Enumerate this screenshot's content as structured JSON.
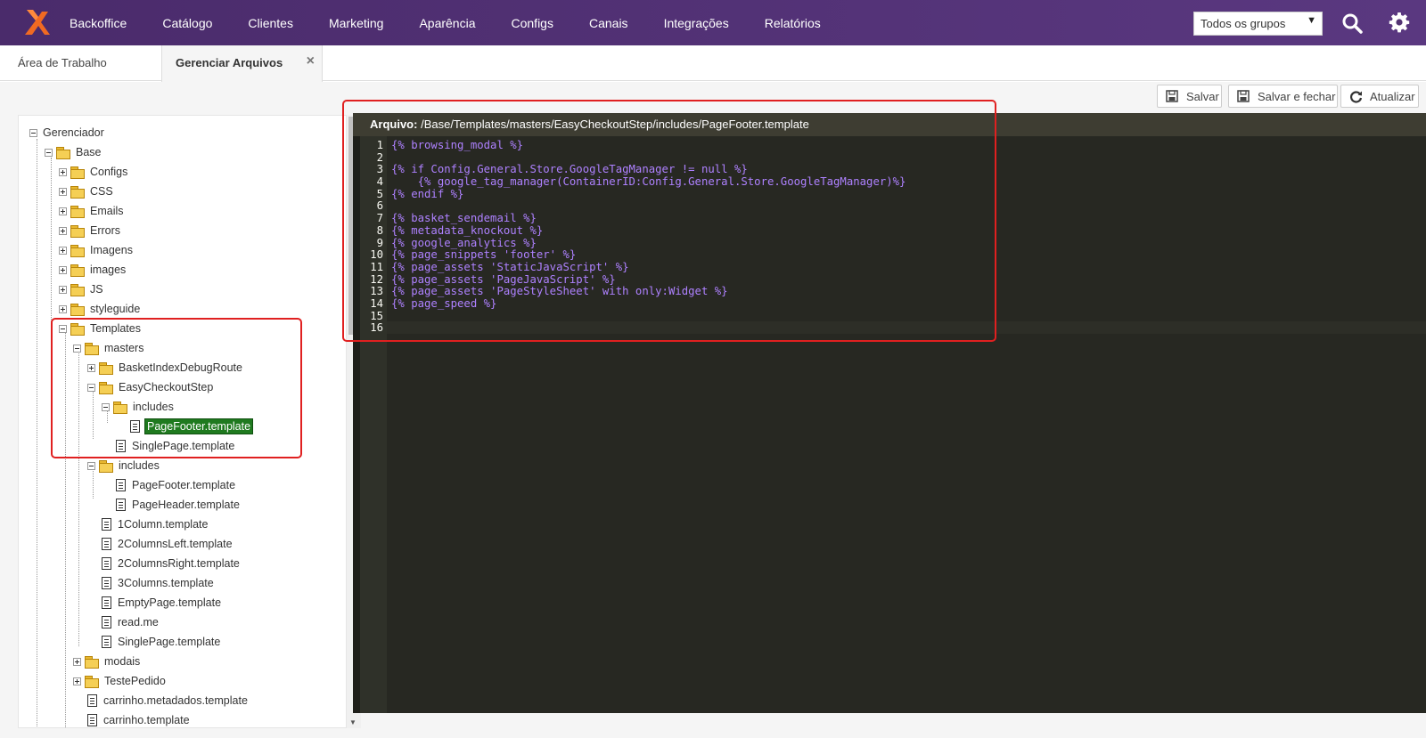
{
  "topbar": {
    "nav": [
      "Backoffice",
      "Catálogo",
      "Clientes",
      "Marketing",
      "Aparência",
      "Configs",
      "Canais",
      "Integrações",
      "Relatórios"
    ],
    "group_select": "Todos os grupos"
  },
  "tabs": {
    "desktop": "Área de Trabalho",
    "files": "Gerenciar Arquivos",
    "close": "×"
  },
  "toolbar": {
    "save": "Salvar",
    "save_close": "Salvar e fechar",
    "refresh": "Atualizar"
  },
  "tree": {
    "root": "Gerenciador",
    "base": "Base",
    "base_folders": [
      "Configs",
      "CSS",
      "Emails",
      "Errors",
      "Imagens",
      "images",
      "JS",
      "styleguide"
    ],
    "templates": "Templates",
    "masters": "masters",
    "basket_debug": "BasketIndexDebugRoute",
    "easy_checkout": "EasyCheckoutStep",
    "ec_includes": "includes",
    "ec_pagefooter": "PageFooter.template",
    "ec_singlepage": "SinglePage.template",
    "t_includes": "includes",
    "t_includes_files": [
      "PageFooter.template",
      "PageHeader.template"
    ],
    "t_files": [
      "1Column.template",
      "2ColumnsLeft.template",
      "2ColumnsRight.template",
      "3Columns.template",
      "EmptyPage.template",
      "read.me",
      "SinglePage.template"
    ],
    "modais": "modais",
    "teste_pedido": "TestePedido",
    "root_files": [
      "carrinho.metadados.template",
      "carrinho.template"
    ]
  },
  "editor": {
    "file_label": "Arquivo:",
    "file_path": "/Base/Templates/masters/EasyCheckoutStep/includes/PageFooter.template",
    "lines": [
      "{% browsing_modal %}",
      "",
      "{% if Config.General.Store.GoogleTagManager != null %}",
      "    {% google_tag_manager(ContainerID:Config.General.Store.GoogleTagManager)%}",
      "{% endif %}",
      "",
      "{% basket_sendemail %}",
      "{% metadata_knockout %}",
      "{% google_analytics %}",
      "{% page_snippets 'footer' %}",
      "{% page_assets 'StaticJavaScript' %}",
      "{% page_assets 'PageJavaScript' %}",
      "{% page_assets 'PageStyleSheet' with only:Widget %}",
      "{% page_speed %}",
      "",
      ""
    ],
    "line_numbers": [
      "1",
      "2",
      "3",
      "4",
      "5",
      "6",
      "7",
      "8",
      "9",
      "10",
      "11",
      "12",
      "13",
      "14",
      "15",
      "16"
    ]
  },
  "colors": {
    "topbar": "#4a2b6b",
    "selected_node": "#1f7a1f",
    "editor_bg": "#272822",
    "code_text": "#ae81ff",
    "annotation": "#e02020"
  }
}
